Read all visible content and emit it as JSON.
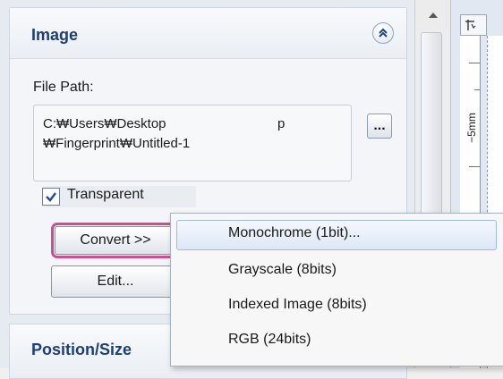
{
  "image_section": {
    "title": "Image",
    "file_path_label": "File Path:",
    "file_path_line1": "C:₩Users₩Desktop",
    "file_path_suffix": "p",
    "file_path_line2": "₩Fingerprint₩Untitled-1",
    "browse_label": "...",
    "transparent_label": "Transparent",
    "transparent_checked": true,
    "convert_label": "Convert >>",
    "edit_label": "Edit..."
  },
  "position_section": {
    "title": "Position/Size"
  },
  "ruler": {
    "label": "−5mm"
  },
  "convert_menu": {
    "items": [
      {
        "label": "Monochrome (1bit)..."
      },
      {
        "label": "Grayscale (8bits)"
      },
      {
        "label": "Indexed Image (8bits)"
      },
      {
        "label": "RGB (24bits)"
      }
    ]
  },
  "colors": {
    "section_title": "#1d3f77",
    "highlight_border": "#d44a8e"
  },
  "icons": {
    "collapse": "double-chevron-up-icon",
    "checkbox": "checkmark-icon",
    "scroll_up": "triangle-up-icon",
    "ruler_corner": "ruler-corner-icon"
  }
}
